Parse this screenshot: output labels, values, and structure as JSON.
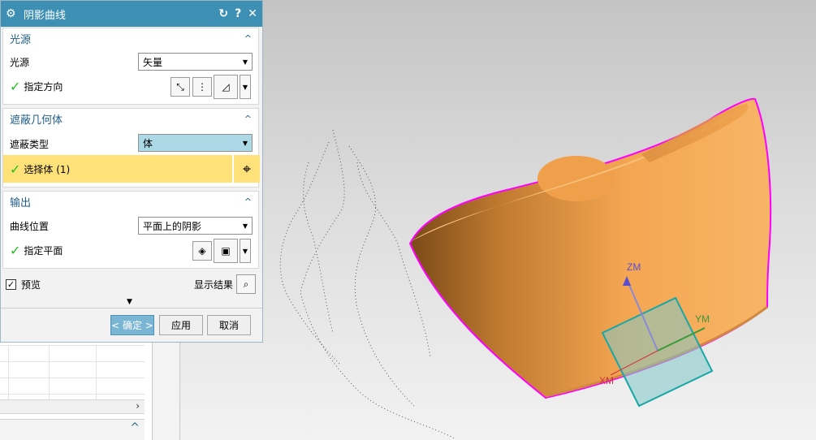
{
  "dialog": {
    "title": "阴影曲线",
    "light_source": {
      "header": "光源",
      "source_label": "光源",
      "source_value": "矢量",
      "direction_label": "指定方向"
    },
    "occlusion": {
      "header": "遮蔽几何体",
      "type_label": "遮蔽类型",
      "type_value": "体",
      "select_label": "选择体 (1)"
    },
    "output": {
      "header": "输出",
      "curve_pos_label": "曲线位置",
      "curve_pos_value": "平面上的阴影",
      "plane_label": "指定平面"
    },
    "preview_label": "预览",
    "show_result_label": "显示结果",
    "ok_label": "< 确定 >",
    "apply_label": "应用",
    "cancel_label": "取消"
  },
  "viewport": {
    "axis_z": "ZM",
    "axis_y": "YM",
    "axis_x": "XM",
    "colors": {
      "body": "#f0a04a",
      "edge": "#ff00ff",
      "csys": "#1aa6a6",
      "axis_z": "#5a4fcf",
      "axis_y": "#3a9a3a",
      "axis_x": "#d0303a"
    }
  }
}
